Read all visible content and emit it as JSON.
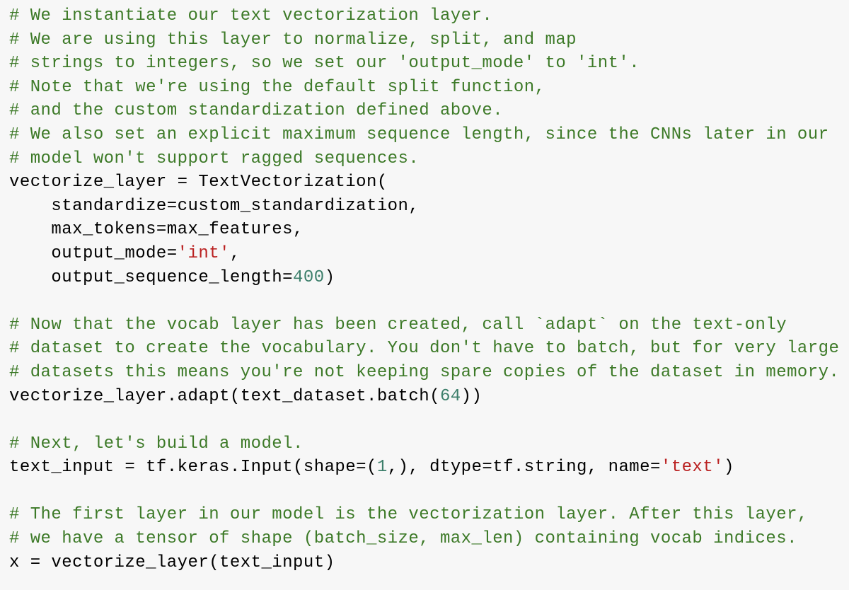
{
  "colors": {
    "background": "#f7f7f7",
    "comment": "#3d7a28",
    "string": "#ba2121",
    "number": "#3d7f6b",
    "text": "#000000"
  },
  "code_lines": [
    [
      {
        "t": "comment",
        "v": "# We instantiate our text vectorization layer."
      }
    ],
    [
      {
        "t": "comment",
        "v": "# We are using this layer to normalize, split, and map"
      }
    ],
    [
      {
        "t": "comment",
        "v": "# strings to integers, so we set our 'output_mode' to 'int'."
      }
    ],
    [
      {
        "t": "comment",
        "v": "# Note that we're using the default split function,"
      }
    ],
    [
      {
        "t": "comment",
        "v": "# and the custom standardization defined above."
      }
    ],
    [
      {
        "t": "comment",
        "v": "# We also set an explicit maximum sequence length, since the CNNs later in our"
      }
    ],
    [
      {
        "t": "comment",
        "v": "# model won't support ragged sequences."
      }
    ],
    [
      {
        "t": "text",
        "v": "vectorize_layer = TextVectorization("
      }
    ],
    [
      {
        "t": "text",
        "v": "    standardize=custom_standardization,"
      }
    ],
    [
      {
        "t": "text",
        "v": "    max_tokens=max_features,"
      }
    ],
    [
      {
        "t": "text",
        "v": "    output_mode="
      },
      {
        "t": "string",
        "v": "'int'"
      },
      {
        "t": "text",
        "v": ","
      }
    ],
    [
      {
        "t": "text",
        "v": "    output_sequence_length="
      },
      {
        "t": "number",
        "v": "400"
      },
      {
        "t": "text",
        "v": ")"
      }
    ],
    [],
    [
      {
        "t": "comment",
        "v": "# Now that the vocab layer has been created, call `adapt` on the text-only"
      }
    ],
    [
      {
        "t": "comment",
        "v": "# dataset to create the vocabulary. You don't have to batch, but for very large"
      }
    ],
    [
      {
        "t": "comment",
        "v": "# datasets this means you're not keeping spare copies of the dataset in memory."
      }
    ],
    [
      {
        "t": "text",
        "v": "vectorize_layer.adapt(text_dataset.batch("
      },
      {
        "t": "number",
        "v": "64"
      },
      {
        "t": "text",
        "v": "))"
      }
    ],
    [],
    [
      {
        "t": "comment",
        "v": "# Next, let's build a model."
      }
    ],
    [
      {
        "t": "text",
        "v": "text_input = tf.keras.Input(shape=("
      },
      {
        "t": "number",
        "v": "1"
      },
      {
        "t": "text",
        "v": ",), dtype=tf.string, name="
      },
      {
        "t": "string",
        "v": "'text'"
      },
      {
        "t": "text",
        "v": ")"
      }
    ],
    [],
    [
      {
        "t": "comment",
        "v": "# The first layer in our model is the vectorization layer. After this layer,"
      }
    ],
    [
      {
        "t": "comment",
        "v": "# we have a tensor of shape (batch_size, max_len) containing vocab indices."
      }
    ],
    [
      {
        "t": "text",
        "v": "x = vectorize_layer(text_input)"
      }
    ]
  ]
}
